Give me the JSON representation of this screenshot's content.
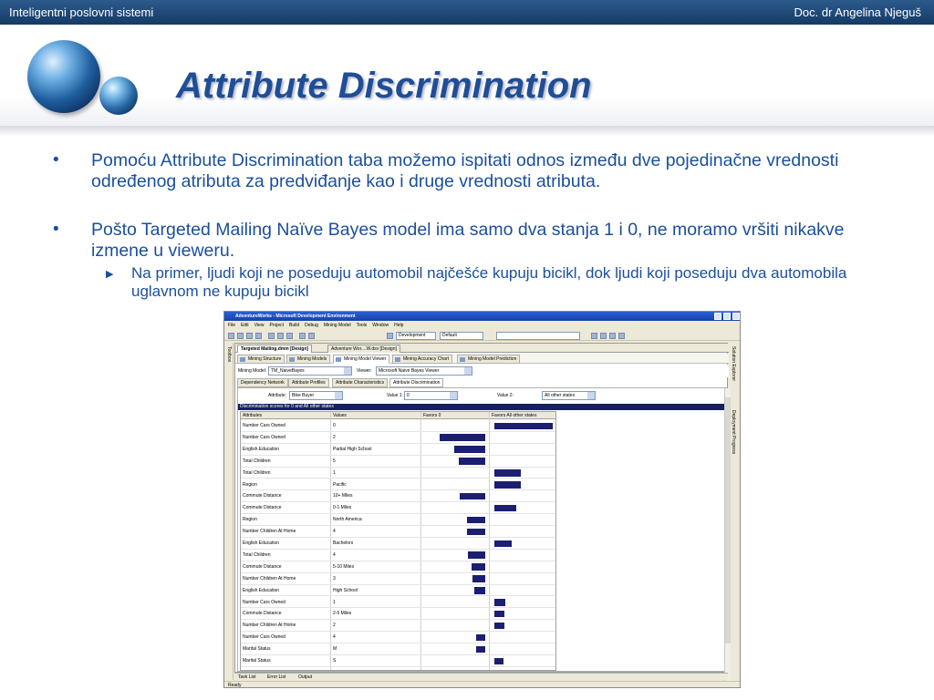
{
  "header": {
    "course": "Inteligentni poslovni sistemi",
    "author": "Doc. dr Angelina Njeguš",
    "title": "Attribute Discrimination"
  },
  "bullets": {
    "b1": "Pomoću Attribute Discrimination taba možemo ispitati odnos između dve pojedinačne vrednosti određenog atributa za predviđanje kao i druge vrednosti atributa.",
    "b2": "Pošto Targeted Mailing Naïve Bayes model ima samo dva stanja 1 i 0, ne moramo vršiti nikakve izmene u vieweru.",
    "sub1": "Na primer, ljudi koji ne poseduju automobil najčešće kupuju bicikl, dok ljudi koji poseduju dva automobila uglavnom ne kupuju bicikl"
  },
  "screenshot": {
    "window_title": "AdventureWorks - Microsoft Development Environment",
    "menu": [
      "File",
      "Edit",
      "View",
      "Project",
      "Build",
      "Debug",
      "Mining Model",
      "Tools",
      "Window",
      "Help"
    ],
    "toolbar": {
      "config": "Development",
      "platform": "Default"
    },
    "left_panel": "Toolbox",
    "right_panels": [
      "Solution Explorer",
      "Deployment Progress"
    ],
    "doc_tabs": [
      "Targeted Mailing.dmm [Design]",
      "Adventure Wor....W.dsv [Design]"
    ],
    "designer_tabs": [
      "Mining Structure",
      "Mining Models",
      "Mining Model Viewer",
      "Mining Accuracy Chart",
      "Mining Model Prediction"
    ],
    "mining_model_label": "Mining Model:",
    "mining_model_value": "TM_NaiveBayes",
    "viewer_label": "Viewer:",
    "viewer_value": "Microsoft Naive Bayes Viewer",
    "attr_tabs": [
      "Dependency Network",
      "Attribute Profiles",
      "Attribute Characteristics",
      "Attribute Discrimination"
    ],
    "attribute_label": "Attribute:",
    "attribute_value": "Bike Buyer",
    "value1_label": "Value 1:",
    "value1_value": "0",
    "value2_label": "Value 2:",
    "value2_value": "All other states",
    "scores_header": "Discrimination scores for 0 and All other states",
    "columns": [
      "Attributes",
      "Values",
      "Favors 0",
      "Favors All other states"
    ],
    "rows": [
      {
        "attr": "Number Cars Owned",
        "value": "0",
        "favors0": 0,
        "favorsOther": 100
      },
      {
        "attr": "Number Cars Owned",
        "value": "2",
        "favors0": 78,
        "favorsOther": 0
      },
      {
        "attr": "English Education",
        "value": "Partial High School",
        "favors0": 53,
        "favorsOther": 0
      },
      {
        "attr": "Total Children",
        "value": "5",
        "favors0": 45,
        "favorsOther": 0
      },
      {
        "attr": "Total Children",
        "value": "1",
        "favors0": 0,
        "favorsOther": 45
      },
      {
        "attr": "Region",
        "value": "Pacific",
        "favors0": 0,
        "favorsOther": 45
      },
      {
        "attr": "Commute Distance",
        "value": "10+ Miles",
        "favors0": 43,
        "favorsOther": 0
      },
      {
        "attr": "Commute Distance",
        "value": "0-1 Miles",
        "favors0": 0,
        "favorsOther": 37
      },
      {
        "attr": "Region",
        "value": "North America",
        "favors0": 32,
        "favorsOther": 0
      },
      {
        "attr": "Number Children At Home",
        "value": "4",
        "favors0": 31,
        "favorsOther": 0
      },
      {
        "attr": "English Education",
        "value": "Bachelors",
        "favors0": 0,
        "favorsOther": 30
      },
      {
        "attr": "Total Children",
        "value": "4",
        "favors0": 30,
        "favorsOther": 0
      },
      {
        "attr": "Commute Distance",
        "value": "5-10 Miles",
        "favors0": 23,
        "favorsOther": 0
      },
      {
        "attr": "Number Children At Home",
        "value": "3",
        "favors0": 22,
        "favorsOther": 0
      },
      {
        "attr": "English Education",
        "value": "High School",
        "favors0": 18,
        "favorsOther": 0
      },
      {
        "attr": "Number Cars Owned",
        "value": "1",
        "favors0": 0,
        "favorsOther": 18
      },
      {
        "attr": "Commute Distance",
        "value": "2-5 Miles",
        "favors0": 0,
        "favorsOther": 17
      },
      {
        "attr": "Number Children At Home",
        "value": "2",
        "favors0": 0,
        "favorsOther": 17
      },
      {
        "attr": "Number Cars Owned",
        "value": "4",
        "favors0": 16,
        "favorsOther": 0
      },
      {
        "attr": "Marital Status",
        "value": "M",
        "favors0": 15,
        "favorsOther": 0
      },
      {
        "attr": "Marital Status",
        "value": "S",
        "favors0": 0,
        "favorsOther": 15
      }
    ],
    "bottom_tabs": [
      "Task List",
      "Error List",
      "Output"
    ],
    "status": "Ready"
  }
}
